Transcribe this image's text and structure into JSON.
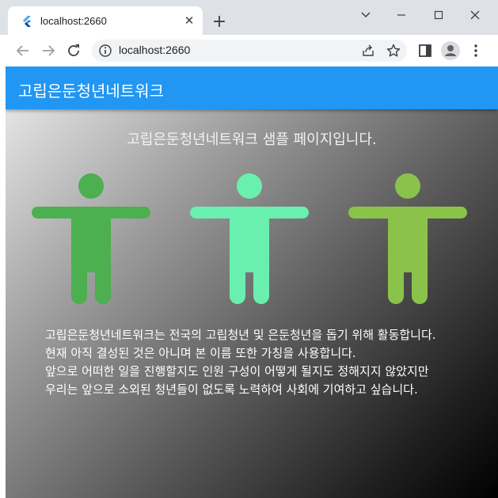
{
  "browser": {
    "tab_title": "localhost:2660",
    "tab_close": "✕",
    "new_tab": "+",
    "url": "localhost:2660"
  },
  "app": {
    "title": "고립은둔청년네트워크",
    "headline": "고립은둔청년네트워크 샘플 페이지입니다.",
    "figures": [
      {
        "color": "#4caf50"
      },
      {
        "color": "#69f0ae"
      },
      {
        "color": "#8bc34a"
      }
    ],
    "description": [
      "고립은둔청년네트워크는 전국의 고립청년 및 은둔청년을 돕기 위해 활동합니다.",
      "현재 아직 결성된 것은 아니며 본 이름 또한 가칭을 사용합니다.",
      "앞으로 어떠한 일을 진행할지도 인원 구성이 어떻게 될지도 정해지지 않았지만",
      "우리는 앞으로 소외된 청년들이 없도록 노력하여 사회에 기여하고 싶습니다."
    ]
  },
  "colors": {
    "appbar": "#2196f3",
    "tabstrip": "#dee1e6"
  }
}
